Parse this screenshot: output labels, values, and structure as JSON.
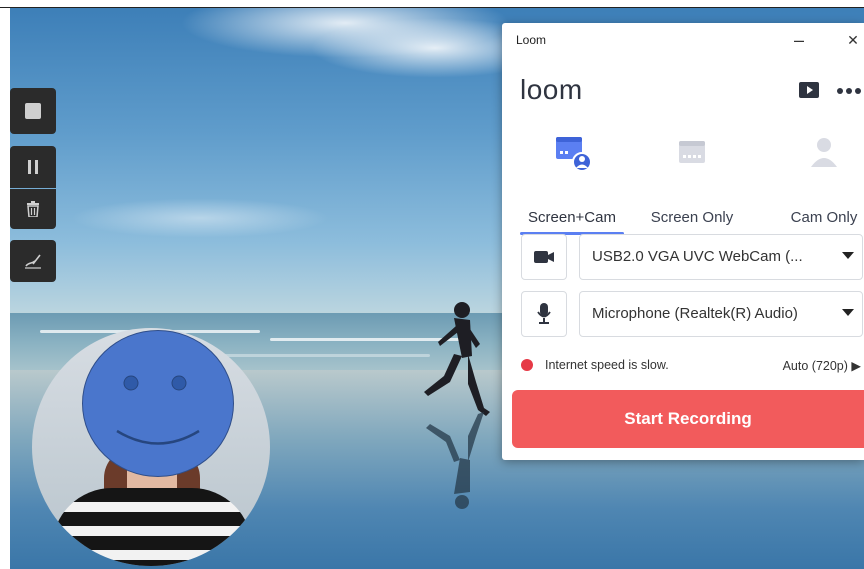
{
  "app": {
    "window_title": "Loom",
    "logo_text": "loom",
    "minimize_glyph": "–",
    "close_glyph": "✕"
  },
  "header_icons": [
    "video-library-icon",
    "more-options-icon"
  ],
  "modes": [
    {
      "label": "Screen+Cam",
      "icon": "screen-cam-icon",
      "selected": true
    },
    {
      "label": "Screen Only",
      "icon": "screen-only-icon",
      "selected": false
    },
    {
      "label": "Cam Only",
      "icon": "cam-only-icon",
      "selected": false
    }
  ],
  "devices": {
    "camera": {
      "icon": "camera-icon",
      "value": "USB2.0 VGA UVC WebCam (..."
    },
    "microphone": {
      "icon": "microphone-icon",
      "value": "Microphone (Realtek(R) Audio)"
    }
  },
  "status": {
    "text": "Internet speed is slow.",
    "quality": "Auto (720p) ▶",
    "dot_color": "#e63946"
  },
  "start_button": {
    "label": "Start Recording",
    "color": "#f25b5c"
  },
  "accent_color": "#5b7ff2",
  "recording_controls": [
    "stop-icon",
    "pause-icon",
    "trash-icon",
    "draw-icon"
  ],
  "webcam_overlay": {
    "face_cover": "smiley-face-icon"
  }
}
